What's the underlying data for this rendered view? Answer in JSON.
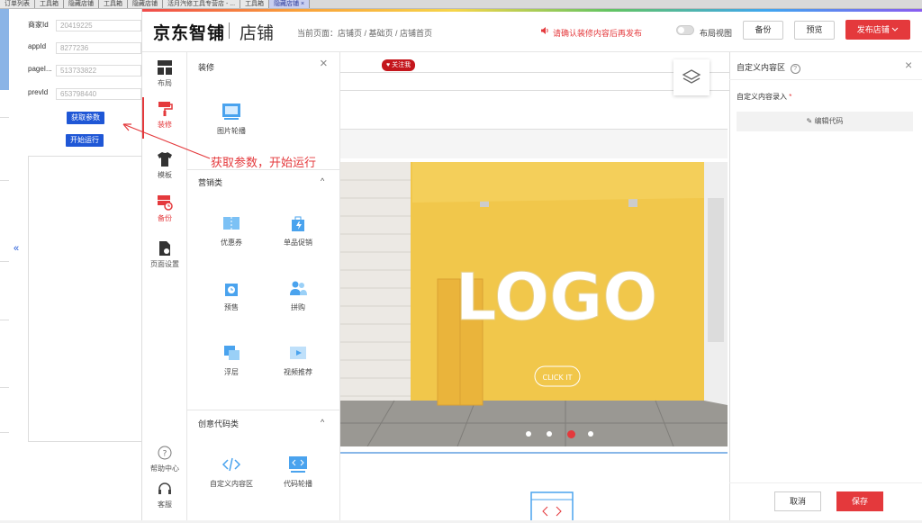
{
  "tabs": [
    "订单列表",
    "工具箱",
    "隐藏店铺",
    "工具箱",
    "隐藏店铺",
    "活月汽修工具专营店 - ...",
    "工具箱",
    "隐藏店铺 ×"
  ],
  "left_form": {
    "fields": [
      {
        "label": "商家Id",
        "value": "20419225"
      },
      {
        "label": "appId",
        "value": "8277236"
      },
      {
        "label": "pageI...",
        "value": "513733822"
      },
      {
        "label": "prevId",
        "value": "653798440"
      }
    ],
    "get_params": "获取参数",
    "start_run": "开始运行",
    "collapse": "«"
  },
  "header": {
    "logo": "京东智铺",
    "logo_sub": "店铺",
    "breadcrumb": "当前页面：店铺页 / 基础页 / 店铺首页",
    "notice": "请确认装修内容后再发布",
    "layout_view": "布局视图",
    "backup": "备份",
    "preview": "预览",
    "publish": "发布店铺"
  },
  "iconbar": {
    "layout": "布局",
    "decorate": "装修",
    "template": "模板",
    "backup": "备份",
    "page_settings": "页面设置",
    "help": "帮助中心",
    "service": "客服"
  },
  "panel": {
    "title": "装修",
    "close": "×",
    "image_carousel": "图片轮播",
    "marketing": "营销类",
    "coupon": "优惠券",
    "single_promo": "单品促销",
    "presale": "预售",
    "group_buy": "拼购",
    "float_layer": "浮层",
    "video_rec": "视频推荐",
    "creative": "创意代码类",
    "custom_area": "自定义内容区",
    "code_carousel": "代码轮播",
    "chev": "^"
  },
  "canvas": {
    "follow": "关注我",
    "banner_logo": "LOGO",
    "banner_btn": "CLICK IT",
    "dots": 4,
    "active_dot": 2
  },
  "right": {
    "title": "自定义内容区",
    "help": "?",
    "close": "×",
    "label": "自定义内容录入",
    "required": "*",
    "edit_code": "编辑代码",
    "cancel": "取消",
    "save": "保存"
  },
  "annotation": "获取参数，开始运行"
}
